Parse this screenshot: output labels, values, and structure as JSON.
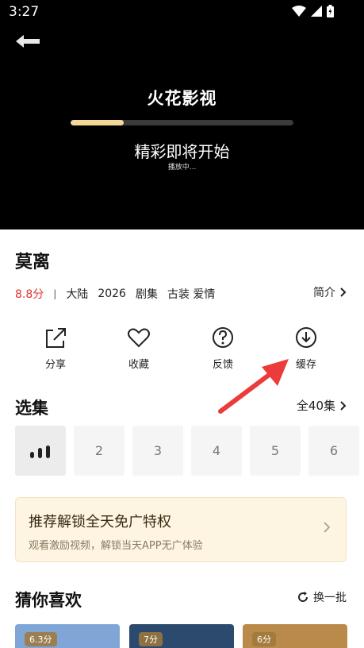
{
  "status_bar": {
    "time": "3:27"
  },
  "player": {
    "brand": "火花影视",
    "progress": 0.24,
    "message": "精彩即将开始",
    "sub_message": "播放中..."
  },
  "show": {
    "title": "莫离",
    "score": "8.8分",
    "separator": "|",
    "region": "大陆",
    "year": "2026",
    "type": "剧集",
    "tags": "古装 爱情",
    "intro_label": "简介"
  },
  "actions": [
    {
      "label": "分享",
      "icon": "share-icon"
    },
    {
      "label": "收藏",
      "icon": "heart-icon"
    },
    {
      "label": "反馈",
      "icon": "help-icon"
    },
    {
      "label": "缓存",
      "icon": "download-icon"
    }
  ],
  "episodes": {
    "title": "选集",
    "all_label": "全40集",
    "items": [
      "playing",
      "2",
      "3",
      "4",
      "5",
      "6"
    ]
  },
  "promo": {
    "title": "推荐解锁全天免广特权",
    "subtitle": "观看激励视频，解锁当天APP无广体验"
  },
  "recommend": {
    "title": "猜你喜欢",
    "refresh_label": "换一批",
    "items": [
      {
        "badge": "6.3分",
        "color": "#7fa6d6"
      },
      {
        "badge": "7分",
        "color": "#2c4a6e"
      },
      {
        "badge": "6分",
        "color": "#b98a4a"
      }
    ]
  },
  "colors": {
    "accent_red": "#e0322e",
    "progress": "#f3d89a",
    "arrow": "#ec3b3b"
  }
}
